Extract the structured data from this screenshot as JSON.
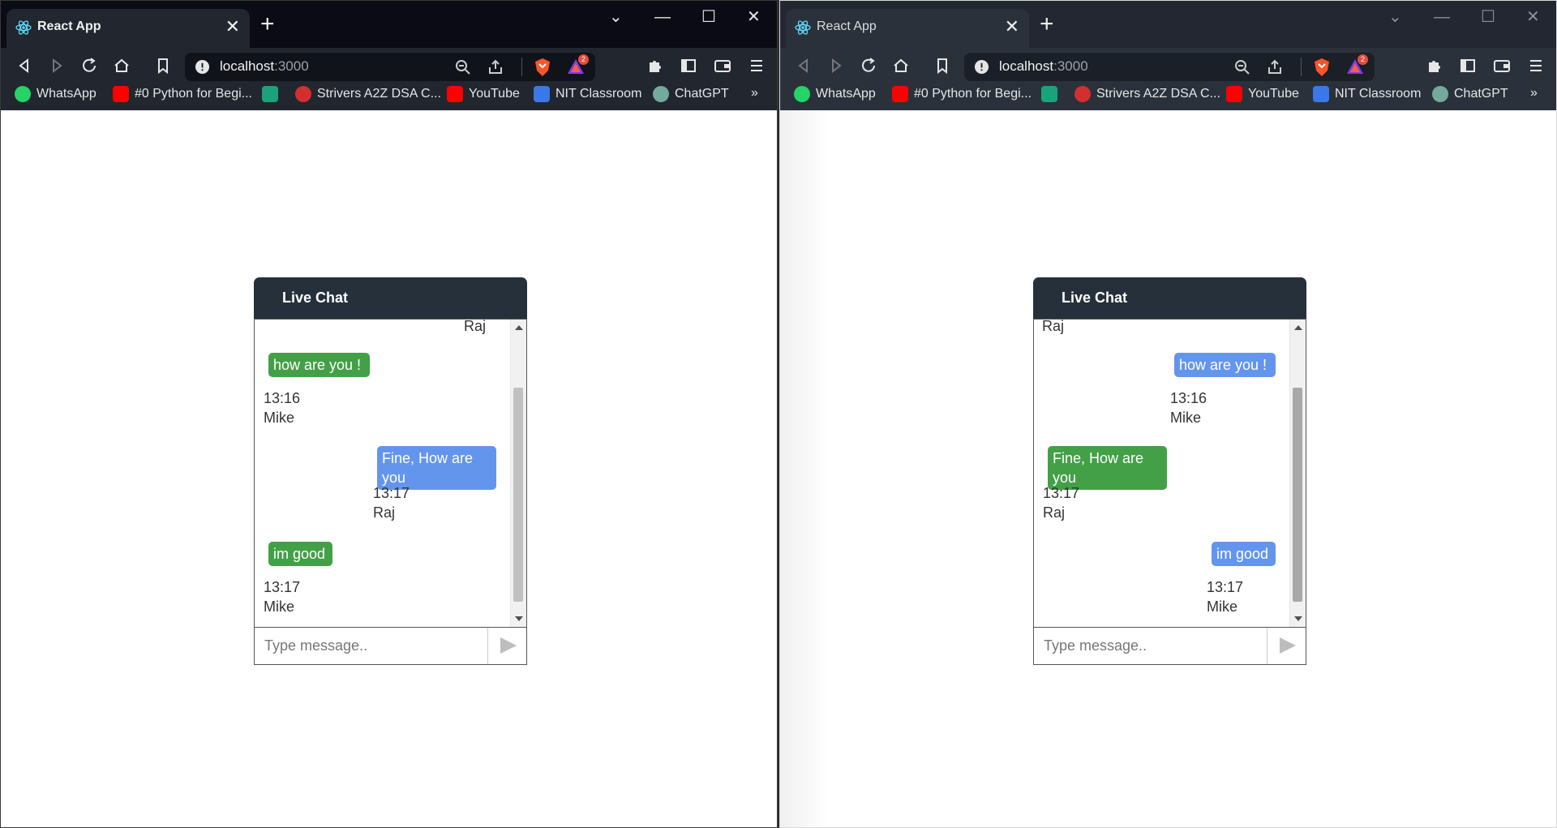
{
  "browser": {
    "tab_title": "React App",
    "url_host": "localhost",
    "url_port": ":3000",
    "notification_count": "2",
    "bookmarks": [
      {
        "label": "WhatsApp",
        "icon": "whatsapp-icon"
      },
      {
        "label": "#0 Python for Begi...",
        "icon": "youtube-icon"
      },
      {
        "label": "",
        "icon": "extension-bookmark-icon"
      },
      {
        "label": "Strivers A2Z DSA C...",
        "icon": "tuf-icon"
      },
      {
        "label": "YouTube",
        "icon": "youtube-icon"
      },
      {
        "label": "NIT Classroom",
        "icon": "classroom-icon"
      },
      {
        "label": "ChatGPT",
        "icon": "chatgpt-icon"
      }
    ],
    "overflow_label": "»"
  },
  "left_chat": {
    "header": "Live Chat",
    "partial_top_name": "Raj",
    "messages": [
      {
        "text": "how are you !",
        "time": "13:16",
        "sender": "Mike",
        "color": "#43a047"
      },
      {
        "text": "Fine, How are you",
        "time": "13:17",
        "sender": "Raj",
        "color": "#6495ed"
      },
      {
        "text": "im good",
        "time": "13:17",
        "sender": "Mike",
        "color": "#43a047"
      }
    ],
    "input_placeholder": "Type message.."
  },
  "right_chat": {
    "header": "Live Chat",
    "partial_top_name": "Raj",
    "messages": [
      {
        "text": "how are you !",
        "time": "13:16",
        "sender": "Mike",
        "color": "#6495ed"
      },
      {
        "text": "Fine, How are you",
        "time": "13:17",
        "sender": "Raj",
        "color": "#43a047"
      },
      {
        "text": "im good",
        "time": "13:17",
        "sender": "Mike",
        "color": "#6495ed"
      }
    ],
    "input_placeholder": "Type message.."
  }
}
